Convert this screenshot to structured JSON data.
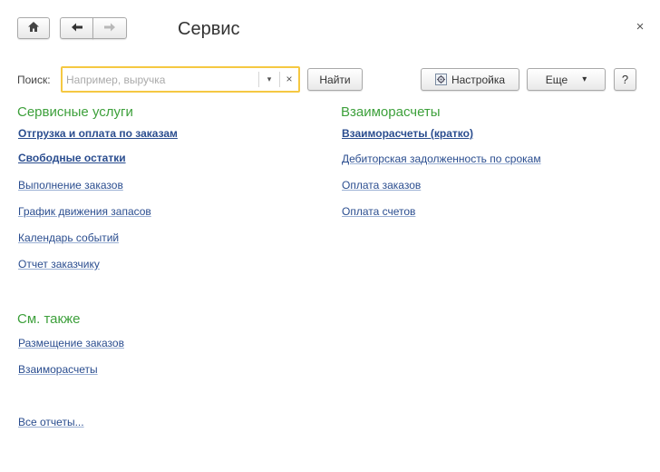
{
  "window": {
    "title": "Сервис",
    "close_icon": "×"
  },
  "nav": {
    "home_icon": "home-icon",
    "back_icon": "arrow-left-icon",
    "forward_icon": "arrow-right-icon"
  },
  "search": {
    "label": "Поиск:",
    "placeholder": "Например, выручка",
    "value": "",
    "dropdown_icon": "▾",
    "clear_icon": "×",
    "find_button": "Найти"
  },
  "toolbar": {
    "settings_label": "Настройка",
    "more_label": "Еще",
    "more_arrow": "▾",
    "help_label": "?"
  },
  "sections": {
    "service": {
      "title": "Сервисные услуги",
      "links": [
        "Отгрузка и оплата по заказам",
        "Свободные остатки",
        "Выполнение заказов",
        "График движения запасов",
        "Календарь событий",
        "Отчет заказчику"
      ]
    },
    "settlements": {
      "title": "Взаиморасчеты",
      "links": [
        "Взаиморасчеты (кратко)",
        "Дебиторская задолженность по срокам",
        "Оплата заказов",
        "Оплата счетов"
      ]
    },
    "see_also": {
      "title": "См. также",
      "links": [
        "Размещение заказов",
        "Взаиморасчеты"
      ]
    }
  },
  "all_reports": "Все отчеты...",
  "colors": {
    "accent_green": "#3da03b",
    "link_blue": "#2a4d8f",
    "search_border": "#f5c842"
  }
}
